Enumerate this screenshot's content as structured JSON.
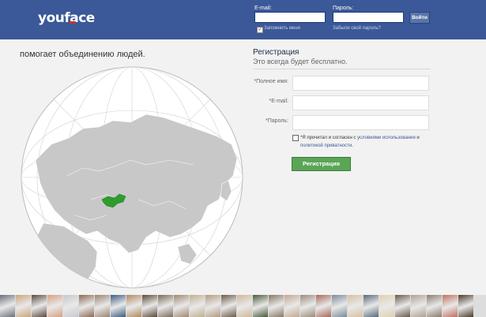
{
  "header": {
    "logo": "youface",
    "email_label": "E-mail:",
    "password_label": "Пароль:",
    "login_button": "Войти",
    "remember_label": "Запомнить меня",
    "forgot_link": "Забыли свой пароль?"
  },
  "left": {
    "tagline": "помогает объединению людей."
  },
  "register": {
    "title": "Регистрация",
    "subtitle": "Это всегда будет бесплатно.",
    "fullname_label": "*Полное имя:",
    "email_label": "*E-mail:",
    "password_label": "*Пароль:",
    "terms_prefix": "*Я прочитал и согласен с",
    "terms_link1": "условиями использования",
    "terms_and": "и",
    "terms_link2": "политикой приватности",
    "terms_end": ".",
    "submit_button": "Регистрация"
  },
  "colors": {
    "header_bg": "#3b5898",
    "accent_green": "#5aa556",
    "highlight_country": "#2e9c2e"
  },
  "strip": {
    "thumbs": [
      "#6a6f7a",
      "#c9a77c",
      "#5a4a3e",
      "#d8a080",
      "#c8c8d0",
      "#8a6a55",
      "#9a8470",
      "#3d5a80",
      "#b08a60",
      "#5c4a38",
      "#7c6a5a",
      "#a08870",
      "#c0b090",
      "#b49a80",
      "#6c5a4a",
      "#d0b898",
      "#4a5a3a",
      "#887766",
      "#c4a890",
      "#9c8a7a",
      "#a86a5a",
      "#7a8a9a",
      "#d8c0a0",
      "#5a6a7a",
      "#e0d0b0",
      "#6a5a4a",
      "#b0a090",
      "#8c7c6c",
      "#c07060",
      "#4c3c2c"
    ]
  }
}
